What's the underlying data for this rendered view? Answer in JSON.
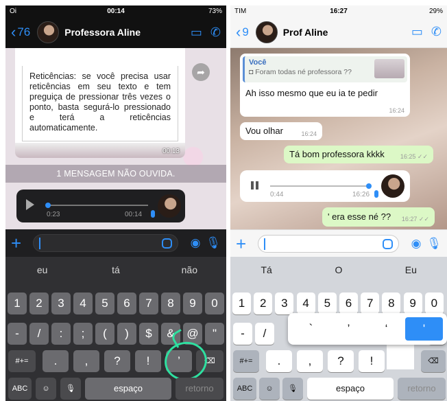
{
  "left": {
    "status": {
      "carrier": "Oi",
      "time": "00:14",
      "battery": "73%"
    },
    "header": {
      "back_count": "76",
      "contact": "Professora Aline",
      "video_icon": "video-camera-icon",
      "call_icon": "phone-icon"
    },
    "quote_text": "Reticências: se você precisa usar reticências em seu texto e tem preguiça de pressionar três vezes o ponto, basta segurá-lo pressionado e terá a reticências automaticamente.",
    "quote_time": "00:13",
    "unread_banner": "1 MENSAGEM NÃO OUVIDA.",
    "voice": {
      "elapsed": "0:23",
      "time": "00:14"
    },
    "suggestions": [
      "eu",
      "tá",
      "não"
    ],
    "row1": [
      "1",
      "2",
      "3",
      "4",
      "5",
      "6",
      "7",
      "8",
      "9",
      "0"
    ],
    "row2": [
      "-",
      "/",
      ":",
      ";",
      "(",
      ")",
      "$",
      "&",
      "@",
      "\""
    ],
    "row3": [
      ".",
      ",",
      "?",
      "!",
      "’"
    ],
    "row3_left": "#+=",
    "abc": "ABC",
    "space": "espaço",
    "return": "retorno"
  },
  "right": {
    "status": {
      "carrier": "TIM",
      "time": "16:27",
      "battery": "29%"
    },
    "header": {
      "back_count": "9",
      "contact": "Prof Aline",
      "video_icon": "video-camera-icon",
      "call_icon": "phone-icon"
    },
    "reply": {
      "author": "Você",
      "quoted": "Foram todas né professora ??",
      "text": "Ah isso mesmo que eu ia te pedir",
      "time": "16:24"
    },
    "olhar": {
      "text": "Vou olhar",
      "time": "16:24"
    },
    "bom": {
      "text": "Tá bom professora kkkk",
      "time": "16:25"
    },
    "voice": {
      "elapsed": "0:44",
      "time": "16:26"
    },
    "era": {
      "text": "' era esse né ??",
      "time": "16:27"
    },
    "suggestions": [
      "Tá",
      "O",
      "Eu"
    ],
    "row1": [
      "1",
      "2",
      "3",
      "4",
      "5",
      "6",
      "7",
      "8",
      "9",
      "0"
    ],
    "row2": [
      "-",
      "/",
      "\""
    ],
    "row3": [
      ".",
      ",",
      "?",
      "!"
    ],
    "row3_left": "#+=",
    "popup": [
      "`",
      "’",
      "‘",
      "'"
    ],
    "abc": "ABC",
    "space": "espaço",
    "return": "retorno"
  }
}
